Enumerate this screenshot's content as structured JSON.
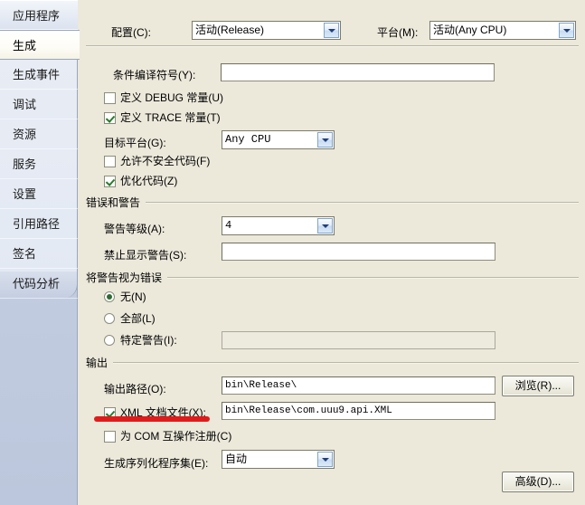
{
  "sidebar": {
    "items": [
      {
        "label": "应用程序",
        "selected": false
      },
      {
        "label": "生成",
        "selected": true
      },
      {
        "label": "生成事件",
        "selected": false
      },
      {
        "label": "调试",
        "selected": false
      },
      {
        "label": "资源",
        "selected": false
      },
      {
        "label": "服务",
        "selected": false
      },
      {
        "label": "设置",
        "selected": false
      },
      {
        "label": "引用路径",
        "selected": false
      },
      {
        "label": "签名",
        "selected": false
      },
      {
        "label": "代码分析",
        "selected": false
      }
    ]
  },
  "top": {
    "config_label": "配置(C):",
    "config_value": "活动(Release)",
    "platform_label": "平台(M):",
    "platform_value": "活动(Any CPU)"
  },
  "general": {
    "cond_symbols_label": "条件编译符号(Y):",
    "cond_symbols_value": "",
    "define_debug_label": "定义 DEBUG 常量(U)",
    "define_debug_checked": false,
    "define_trace_label": "定义 TRACE 常量(T)",
    "define_trace_checked": true,
    "target_platform_label": "目标平台(G):",
    "target_platform_value": "Any CPU",
    "allow_unsafe_label": "允许不安全代码(F)",
    "allow_unsafe_checked": false,
    "optimize_label": "优化代码(Z)",
    "optimize_checked": true
  },
  "errors": {
    "group_label": "错误和警告",
    "warn_level_label": "警告等级(A):",
    "warn_level_value": "4",
    "suppress_label": "禁止显示警告(S):",
    "suppress_value": ""
  },
  "treat": {
    "group_label": "将警告视为错误",
    "none_label": "无(N)",
    "none_selected": true,
    "all_label": "全部(L)",
    "all_selected": false,
    "specific_label": "特定警告(I):",
    "specific_selected": false,
    "specific_value": ""
  },
  "output": {
    "group_label": "输出",
    "path_label": "输出路径(O):",
    "path_value": "bin\\Release\\",
    "browse_label": "浏览(R)...",
    "xml_doc_label": "XML 文档文件(X):",
    "xml_doc_checked": true,
    "xml_doc_value": "bin\\Release\\com.uuu9.api.XML",
    "com_interop_label": "为 COM 互操作注册(C)",
    "com_interop_checked": false,
    "serialization_label": "生成序列化程序集(E):",
    "serialization_value": "自动",
    "advanced_label": "高级(D)..."
  },
  "annotation": {
    "color": "#E01B1B"
  }
}
